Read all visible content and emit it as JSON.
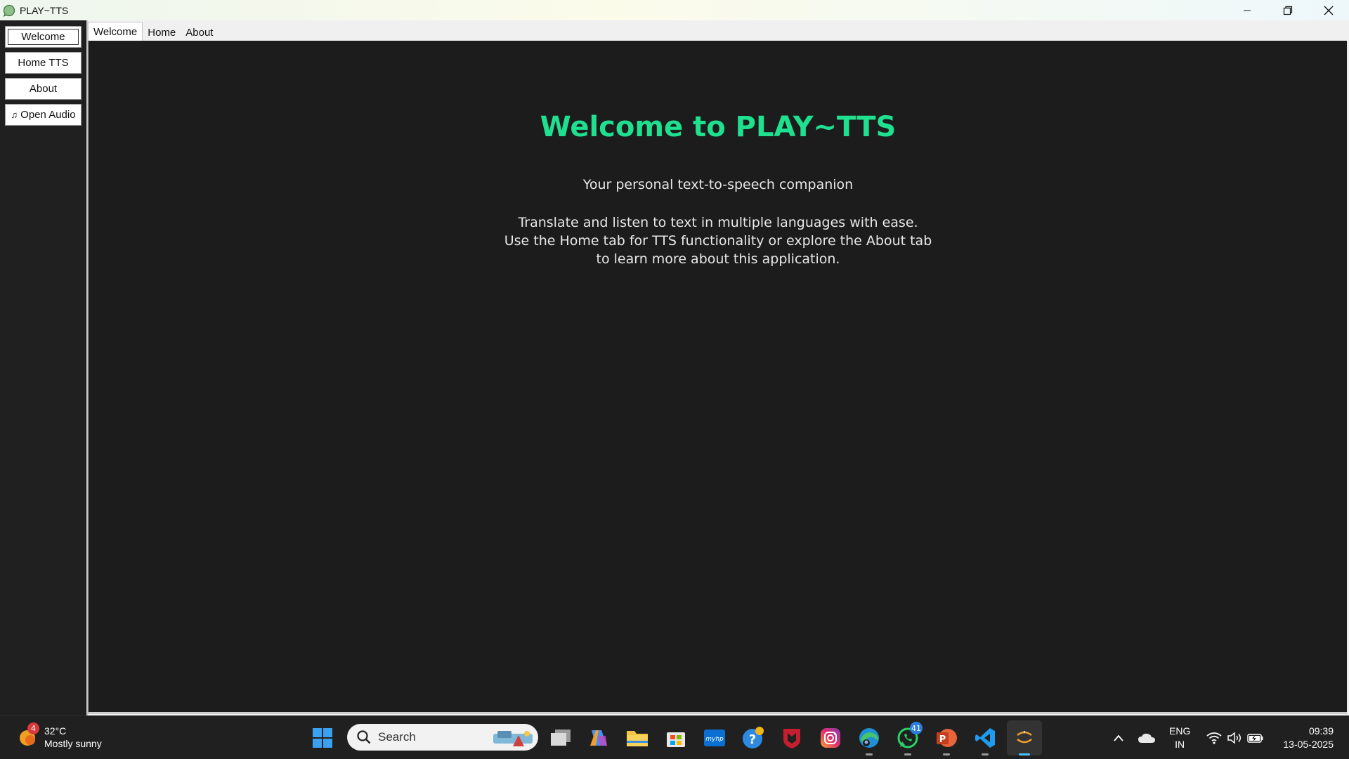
{
  "window": {
    "title": "PLAY~TTS"
  },
  "sidebar": {
    "buttons": [
      {
        "label": "Welcome"
      },
      {
        "label": "Home TTS"
      },
      {
        "label": "About"
      },
      {
        "label": "Open Audio",
        "icon": "music-note-icon"
      }
    ]
  },
  "tabs": [
    {
      "label": "Welcome",
      "active": true
    },
    {
      "label": "Home"
    },
    {
      "label": "About"
    }
  ],
  "main": {
    "title": "Welcome to PLAY~TTS",
    "subtitle": "Your personal text-to-speech companion",
    "description": "Translate and listen to text in multiple languages with ease.\nUse the Home tab for TTS functionality or explore the About tab\nto learn more about this application."
  },
  "colors": {
    "accent": "#1fe08f",
    "background": "#1c1c1c",
    "sidebar": "#202020"
  },
  "taskbar": {
    "weather": {
      "temperature": "32°C",
      "condition": "Mostly sunny",
      "badge": "4"
    },
    "search": {
      "placeholder": "Search"
    },
    "whatsapp_badge": "41",
    "language": {
      "line1": "ENG",
      "line2": "IN"
    },
    "clock": {
      "time": "09:39",
      "date": "13-05-2025"
    }
  }
}
